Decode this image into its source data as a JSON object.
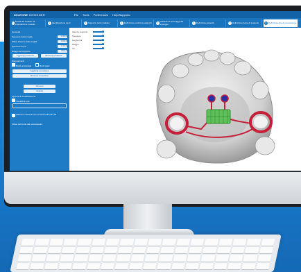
{
  "app": {
    "brand": "3DLEONE",
    "brand_suffix": "DESIGNER",
    "menu": [
      "File",
      "Tools",
      "Preferences",
      "Help/Supporto"
    ]
  },
  "steps": [
    {
      "num": "1",
      "label": "Scelta del modello da impostazione modello"
    },
    {
      "num": "2",
      "label": "Identificazione denti"
    },
    {
      "num": "3",
      "label": "Supporto sotto modello"
    },
    {
      "num": "4",
      "label": "Definizione posizione attacchi"
    },
    {
      "num": "5",
      "label": "Definizione ancoraggi del appoggio"
    },
    {
      "num": "6",
      "label": "Definizione attacchi"
    },
    {
      "num": "7",
      "label": "Definizione barra di supporto"
    },
    {
      "num": "8",
      "label": "Definizione filo di connessione"
    }
  ],
  "sidebar": {
    "header": "Generale",
    "rows": [
      {
        "label": "Spessore della maglia",
        "value": "1.00mm"
      },
      {
        "label": "Offset inferiore della maglia",
        "value": "0.00mm"
      },
      {
        "label": "Spessore barra",
        "value": "1.00mm"
      },
      {
        "label": "Raggio del supporto",
        "value": "0.50mm"
      }
    ],
    "buttons_pair": [
      "Aggiungi posizione",
      "Rimuovi posizione"
    ],
    "section_label": "Stampa bordi",
    "checks": [
      "Bordi arrotondati",
      "Bordi piatti"
    ],
    "buttons": [
      "Aggiungi connettore",
      "Rimuovi connettore"
    ],
    "search_btn": "Rimuovi",
    "apply_btn": "Applica",
    "section2": "Opzioni di visualizzazione",
    "check2": "Visualizza rete",
    "wide_btn": "",
    "note": "Utilizza un alveolo con protezione/bordo dal",
    "footer": "Offset del bordo dal sottosquadro"
  },
  "tools": [
    {
      "label": "Altezza supporto"
    },
    {
      "label": "Spessore"
    },
    {
      "label": "Larghezza"
    },
    {
      "label": "Raggio"
    },
    {
      "label": "Inc"
    }
  ]
}
